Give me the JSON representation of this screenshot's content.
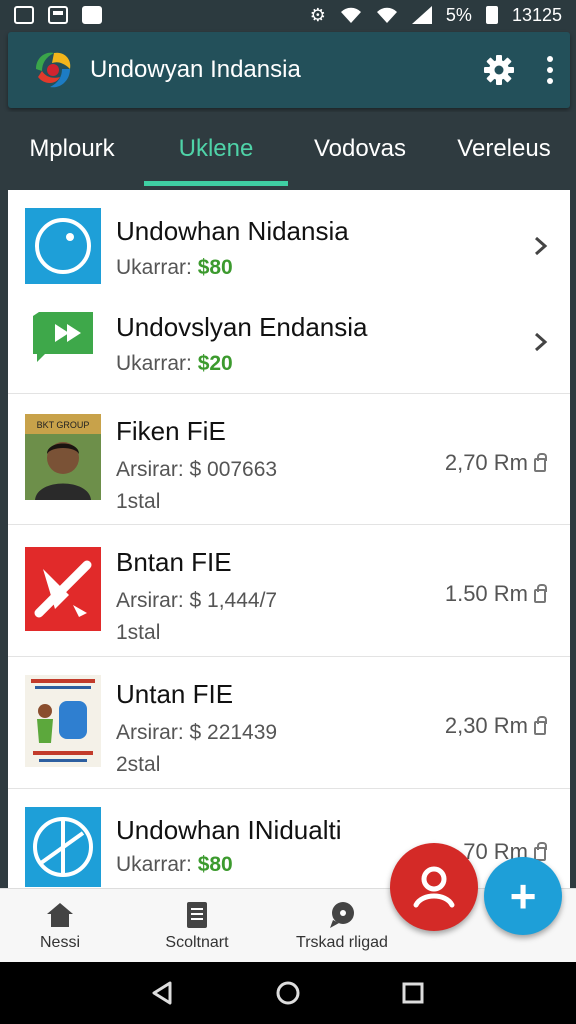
{
  "status_bar": {
    "battery_percent": "5%",
    "time": "13125"
  },
  "app_bar": {
    "title": "Undowyan Indansia"
  },
  "tabs": [
    {
      "label": "Mplourk",
      "active": false
    },
    {
      "label": "Uklene",
      "active": true
    },
    {
      "label": "Vodovas",
      "active": false
    },
    {
      "label": "Vereleus",
      "active": false
    }
  ],
  "rows": [
    {
      "title": "Undowhan Nidansia",
      "sub_label": "Ukarrar: ",
      "price": "$80"
    },
    {
      "title": "Undovslyan Endansia",
      "sub_label": "Ukarrar: ",
      "price": "$20"
    },
    {
      "title": "Fiken FiE",
      "sub_label": "Arsirar: $ 007663",
      "extra": "1stal",
      "time": "2,70 Rm",
      "thumb_text": "BKT GROUP"
    },
    {
      "title": "Bntan FIE",
      "sub_label": "Arsirar: $ 1,444/7",
      "extra": "1stal",
      "time": "1.50 Rm"
    },
    {
      "title": "Untan FIE",
      "sub_label": "Arsirar: $ 221439",
      "extra": "2stal",
      "time": "2,30 Rm"
    },
    {
      "title": "Undowhan INidualti",
      "sub_label": "Ukarrar: ",
      "price": "$80",
      "time": "70 Rm"
    }
  ],
  "bottom_nav": [
    {
      "label": "Nessi",
      "icon": "home-icon"
    },
    {
      "label": "Scoltnart",
      "icon": "document-icon"
    },
    {
      "label": "Trskad rligad",
      "icon": "chat-icon"
    }
  ],
  "fab_add": "+",
  "colors": {
    "app_bar": "#23505a",
    "accent_tab": "#3fcfa3",
    "price_green": "#3c9a2e",
    "fab_red": "#d42a27",
    "fab_blue": "#1e9fd8"
  }
}
